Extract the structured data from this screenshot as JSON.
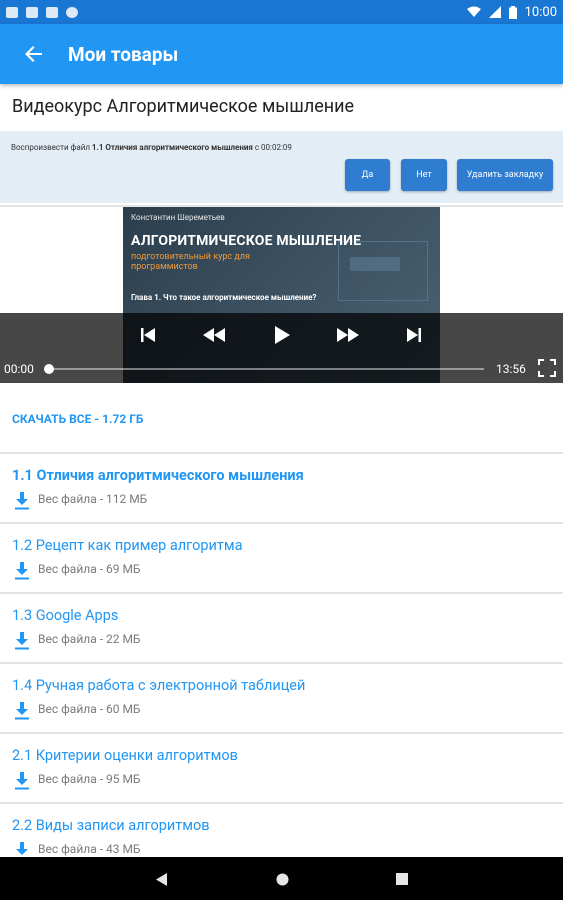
{
  "status_bar": {
    "time": "10:00"
  },
  "app_bar": {
    "title": "Мои товары",
    "back_icon": "arrow-left-icon"
  },
  "course": {
    "title": "Видеокурс Алгоритмическое мышление"
  },
  "bookmark": {
    "prefix": "Воспроизвести файл ",
    "file": "1.1 Отличия алгоритмического мышления",
    "suffix": " с 00:02:09",
    "yes": "Да",
    "no": "Нет",
    "delete": "Удалить закладку"
  },
  "video": {
    "author": "Константин Шереметьев",
    "title": "АЛГОРИТМИЧЕСКОЕ МЫШЛЕНИЕ",
    "subtitle": "подготовительный курс для программистов",
    "chapter": "Глава 1. Что такое алгоритмическое мышление?",
    "current_time": "00:00",
    "duration": "13:56",
    "progress": 0.0
  },
  "download_all": "СКАЧАТЬ ВСЕ - 1.72 ГБ",
  "files": [
    {
      "title": "1.1 Отличия алгоритмического мышления",
      "size": "Вес файла - 112 МБ",
      "active": true
    },
    {
      "title": "1.2 Рецепт как пример алгоритма",
      "size": "Вес файла - 69 МБ",
      "active": false
    },
    {
      "title": "1.3 Google Apps",
      "size": "Вес файла - 22 МБ",
      "active": false
    },
    {
      "title": "1.4 Ручная работа с электронной таблицей",
      "size": "Вес файла - 60 МБ",
      "active": false
    },
    {
      "title": "2.1 Критерии оценки алгоритмов",
      "size": "Вес файла - 95 МБ",
      "active": false
    },
    {
      "title": "2.2 Виды записи алгоритмов",
      "size": "Вес файла - 43 МБ",
      "active": false
    }
  ],
  "colors": {
    "primary": "#2196f3",
    "status": "#1976d2",
    "bookmark_bg": "#e3edf5",
    "button": "#2e7dd1"
  }
}
